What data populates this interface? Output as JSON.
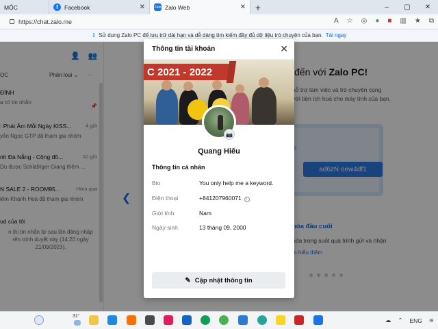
{
  "browser": {
    "tabs": [
      {
        "label": "MỘC",
        "active": false
      },
      {
        "label": "Facebook",
        "active": false
      },
      {
        "label": "Zalo Web",
        "active": true
      }
    ],
    "new_tab_label": "+",
    "url": "https://chat.zalo.me",
    "win_min": "–",
    "win_max": "▢",
    "win_close": "✕"
  },
  "info_strip": {
    "text": "Sử dụng Zalo PC để lưu trữ dài hạn và dễ dàng tìm kiếm đầy đủ dữ liệu trò chuyện của bạn.",
    "link": "Tải ngay"
  },
  "left_panel": {
    "filter_left": "ỌC",
    "filter_right": "Phân loại ⌄",
    "more": "···",
    "conversations": [
      {
        "title": "ĐÌNH",
        "subtitle": "a có tin nhắn",
        "time": ""
      },
      {
        "title": ": Phát Âm Mỗi Ngày KISS...",
        "subtitle": "yễn Ngọc GTP đã tham gia nhóm",
        "time": "4 giờ"
      },
      {
        "title": "nh Đà Nẵng - Cộng đồ...",
        "subtitle": "Du được Schlafriger Giang thêm ...",
        "time": "10 giờ"
      },
      {
        "title": "N SALE 2 - ROOM95...",
        "subtitle": "iếm Khánh Hoà đã tham gia nhóm",
        "time": "Hôm qua"
      },
      {
        "title": "ud của tôi",
        "subtitle": "n thị tin nhắn từ sau lần đăng nhập\nrên trình duyệt này (14:20 ngày\n21/09/2023).",
        "time": ""
      }
    ]
  },
  "main": {
    "welcome_pre": "đến với ",
    "welcome_brand": "Zalo PC!",
    "desc": "hỗ trợ làm việc và trò chuyện cùng\nvới tiện ích hoá cho máy tính của bạn.",
    "key_text": "ad6zN oew4df1",
    "pct": "%",
    "feature_title": "hóa đầu cuối",
    "feature_desc": "hóa trong suốt quá trình gửi và nhận",
    "feature_link": "m hiểu thêm"
  },
  "modal": {
    "title": "Thông tin tài khoản",
    "cover_banner": "C 2021 - 2022",
    "name": "Quang Hiếu",
    "section_title": "Thông tin cá nhân",
    "fields": [
      {
        "label": "Bio",
        "value": "You only help me a keyword."
      },
      {
        "label": "Điện thoại",
        "value": "+841207960071"
      },
      {
        "label": "Giới tính",
        "value": "Nam"
      },
      {
        "label": "Ngày sinh",
        "value": "13 tháng 09, 2000"
      }
    ],
    "update_button": "Cập nhật thông tin"
  },
  "taskbar": {
    "temperature": "31°",
    "lang": "ENG"
  },
  "colors": {
    "accent": "#0068ff",
    "banner_red": "#c0392b"
  }
}
